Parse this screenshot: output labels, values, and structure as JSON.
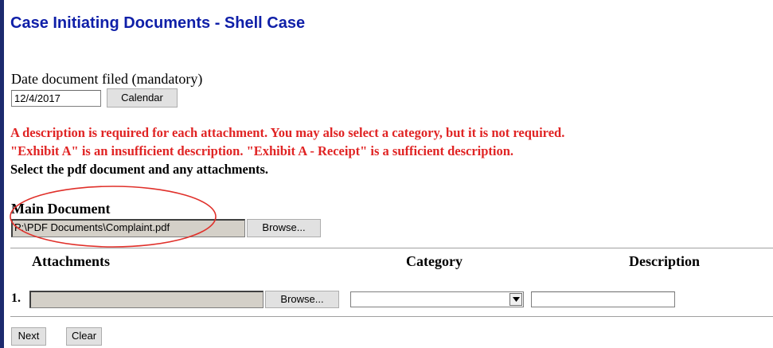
{
  "title": "Case Initiating Documents - Shell Case",
  "date": {
    "label": "Date document filed (mandatory)",
    "value": "12/4/2017",
    "calendar_button": "Calendar"
  },
  "notices": [
    "A description is required for each attachment. You may also select a category, but it is not required.",
    "\"Exhibit A\" is an insufficient description. \"Exhibit A - Receipt\" is a sufficient description."
  ],
  "instruction": "Select the pdf document and any attachments.",
  "main_document": {
    "label": "Main Document",
    "file_path": "P:\\PDF Documents\\Complaint.pdf",
    "browse_button": "Browse..."
  },
  "attachments": {
    "headers": [
      "Attachments",
      "Category",
      "Description"
    ],
    "rows": [
      {
        "number": "1.",
        "file_path": "",
        "browse_button": "Browse...",
        "category": "",
        "description": ""
      }
    ]
  },
  "footer_buttons": {
    "next": "Next",
    "clear": "Clear"
  },
  "colors": {
    "title": "#0f1fa8",
    "notice": "#e02424",
    "annotation": "#e0302a",
    "left_bar": "#1c2a6e"
  }
}
